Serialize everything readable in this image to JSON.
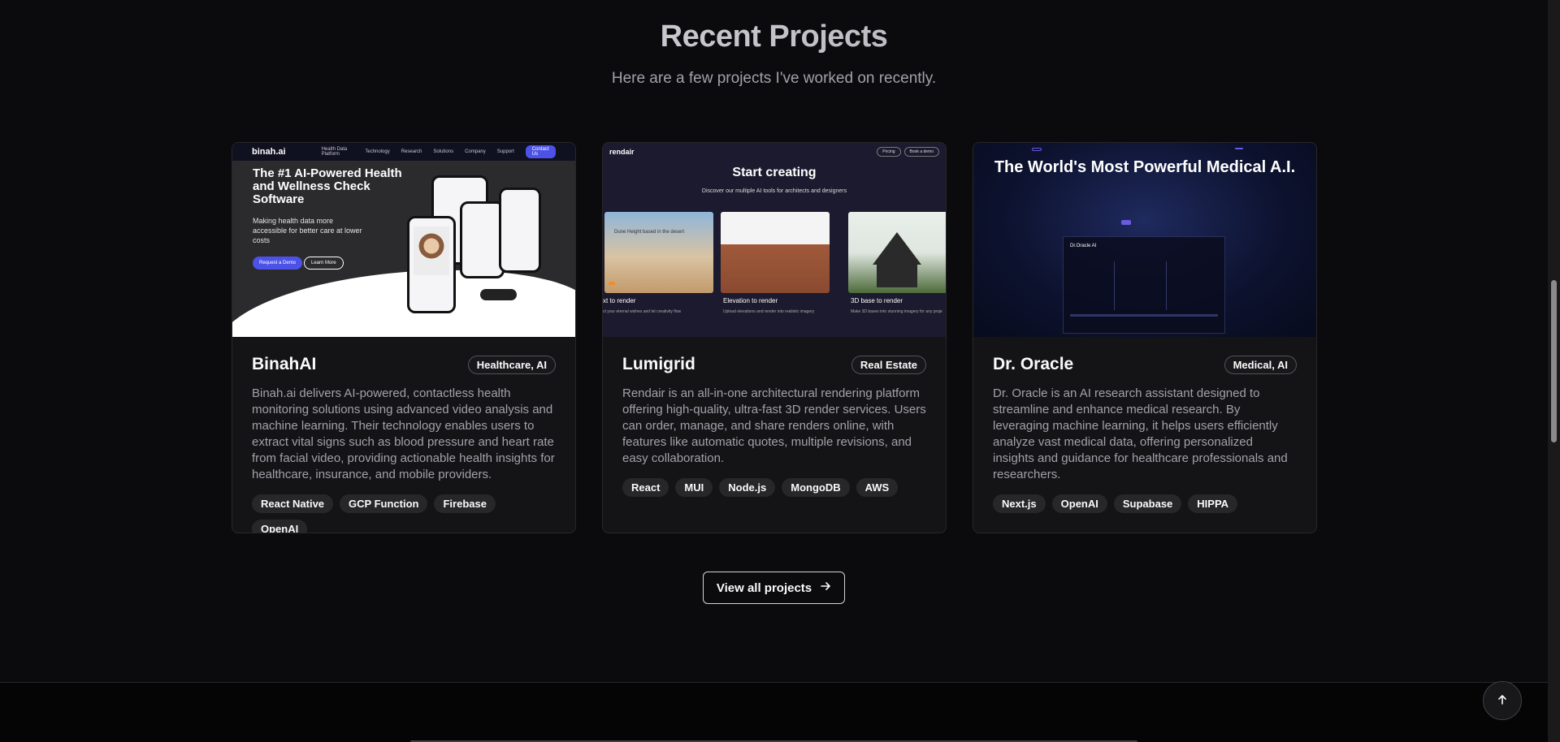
{
  "section": {
    "title": "Recent Projects",
    "subtitle": "Here are a few projects I've worked on recently."
  },
  "projects": [
    {
      "name": "BinahAI",
      "category": "Healthcare, AI",
      "description": "Binah.ai delivers AI-powered, contactless health monitoring solutions using advanced video analysis and machine learning. Their technology enables users to extract vital signs such as blood pressure and heart rate from facial video, providing actionable health insights for healthcare, insurance, and mobile providers.",
      "tech": [
        "React Native",
        "GCP Function",
        "Firebase",
        "OpenAI"
      ],
      "preview": {
        "logo": "binah.ai",
        "nav": [
          "Health Data Platform",
          "Technology",
          "Research",
          "Solutions",
          "Company",
          "Support"
        ],
        "nav_cta": "Contact Us",
        "headline": "The #1 AI-Powered Health and Wellness Check Software",
        "subline": "Making health data more accessible for better care at lower costs",
        "primary_button": "Request a Demo",
        "secondary_button": "Learn More"
      }
    },
    {
      "name": "Lumigrid",
      "category": "Real Estate",
      "description": "Rendair is an all-in-one architectural rendering platform offering high-quality, ultra-fast 3D render services. Users can order, manage, and share renders online, with features like automatic quotes, multiple revisions, and easy collaboration.",
      "tech": [
        "React",
        "MUI",
        "Node.js",
        "MongoDB",
        "AWS"
      ],
      "preview": {
        "logo": "rendair",
        "nav": [
          "Pricing",
          "Book a demo"
        ],
        "headline": "Start creating",
        "subline": "Discover our multiple AI tools for architects and designers",
        "tiles": [
          {
            "title": "xt to render",
            "desc": "ct your eternal wishes and let creativity flow"
          },
          {
            "title": "Elevation to render",
            "desc": "Upload elevations and render into realistic imagery"
          },
          {
            "title": "3D base to render",
            "desc": "Make 3D bases into stunning imagery for any proje"
          }
        ],
        "prompt_text": "Dune Height based in the desert"
      }
    },
    {
      "name": "Dr. Oracle",
      "category": "Medical, AI",
      "description": "Dr. Oracle is an AI research assistant designed to streamline and enhance medical research. By leveraging machine learning, it helps users efficiently analyze vast medical data, offering personalized insights and guidance for healthcare professionals and researchers.",
      "tech": [
        "Next.js",
        "OpenAI",
        "Supabase",
        "HIPPA"
      ],
      "preview": {
        "headline": "The World's Most Powerful Medical A.I.",
        "panel_title": "Dr.Oracle AI"
      }
    }
  ],
  "cta": {
    "view_all": "View all projects"
  },
  "colors": {
    "background": "#0b0b0d",
    "card": "#141416",
    "accent_indigo": "#4c52e8"
  }
}
